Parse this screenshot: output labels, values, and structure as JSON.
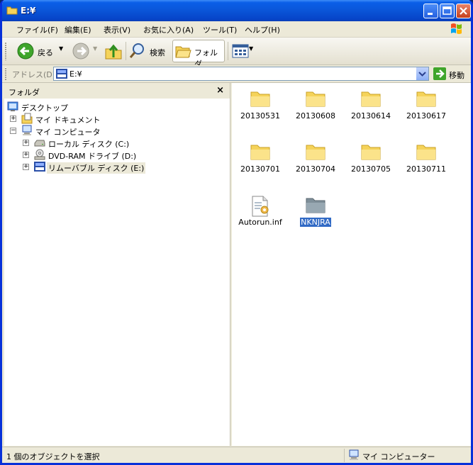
{
  "window": {
    "title": "E:¥"
  },
  "menu": [
    "ファイル(F)",
    "編集(E)",
    "表示(V)",
    "お気に入り(A)",
    "ツール(T)",
    "ヘルプ(H)"
  ],
  "toolbar": {
    "back": "戻る",
    "search": "検索",
    "folders": "フォルダ"
  },
  "address": {
    "label": "アドレス(D)",
    "value": "E:¥",
    "go": "移動"
  },
  "folder_pane": {
    "title": "フォルダ",
    "close": "×",
    "tree": [
      {
        "label": "デスクトップ",
        "icon": "desktop-icon"
      },
      {
        "label": "マイ ドキュメント",
        "icon": "my-documents-icon",
        "expander": "+"
      },
      {
        "label": "マイ コンピュータ",
        "icon": "my-computer-icon",
        "expander": "−"
      },
      {
        "label": "ローカル ディスク (C:)",
        "icon": "local-disk-icon",
        "expander": "+"
      },
      {
        "label": "DVD-RAM ドライブ (D:)",
        "icon": "dvd-drive-icon",
        "expander": "+"
      },
      {
        "label": "リムーバブル ディスク (E:)",
        "icon": "removable-disk-icon",
        "expander": "+",
        "selected": true
      }
    ]
  },
  "files": [
    {
      "name": "20130531",
      "type": "folder"
    },
    {
      "name": "20130608",
      "type": "folder"
    },
    {
      "name": "20130614",
      "type": "folder"
    },
    {
      "name": "20130617",
      "type": "folder"
    },
    {
      "name": "20130701",
      "type": "folder"
    },
    {
      "name": "20130704",
      "type": "folder"
    },
    {
      "name": "20130705",
      "type": "folder"
    },
    {
      "name": "20130711",
      "type": "folder"
    },
    {
      "name": "Autorun.inf",
      "type": "inf-file"
    },
    {
      "name": "NKNJRA",
      "type": "folder-gray",
      "selected": true
    }
  ],
  "status": {
    "left": "1 個のオブジェクトを選択",
    "right": "マイ コンピューター"
  },
  "colors": {
    "title_blue": "#0a55d8",
    "selection": "#316ac5",
    "folder_yellow": "#f5d35a",
    "chrome": "#ece9d8"
  }
}
